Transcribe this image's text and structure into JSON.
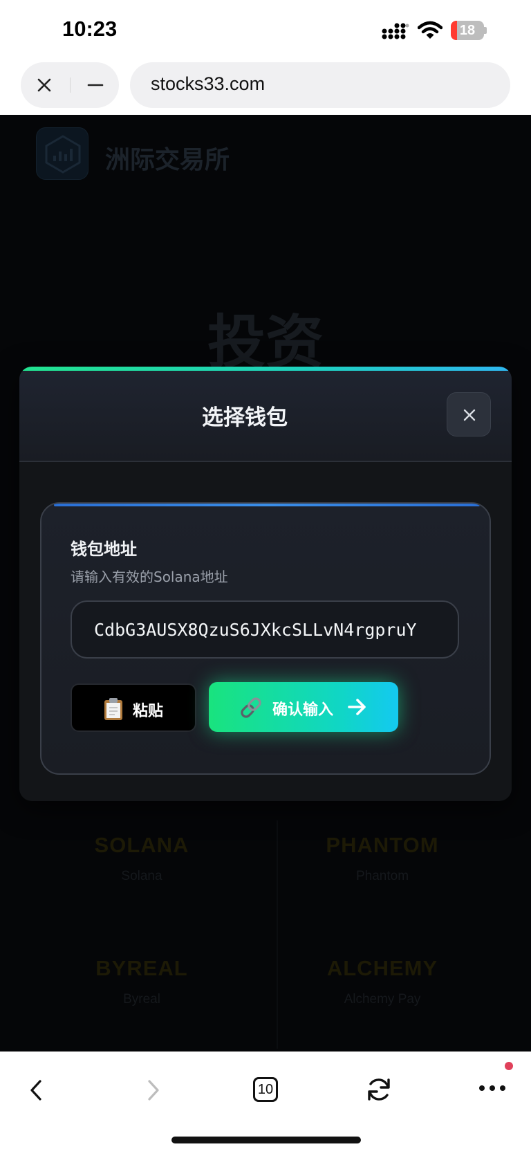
{
  "status_bar": {
    "time": "10:23",
    "battery_level": "18",
    "battery_fraction": 0.18,
    "battery_color": "#ff3b30",
    "icons": [
      "signal-icon",
      "wifi-icon",
      "battery-icon"
    ]
  },
  "browser": {
    "url": "stocks33.com",
    "tabs_count": "10",
    "icons": [
      "close-icon",
      "minimize-icon",
      "back-icon",
      "forward-icon",
      "tabs-icon",
      "reload-icon",
      "more-icon"
    ]
  },
  "page": {
    "brand": "洲际交易所",
    "hero_title": "投资",
    "wallets": [
      {
        "name": "SOLANA",
        "sub": "Solana"
      },
      {
        "name": "PHANTOM",
        "sub": "Phantom"
      },
      {
        "name": "BYREAL",
        "sub": "Byreal"
      },
      {
        "name": "ALCHEMY",
        "sub": "Alchemy Pay"
      }
    ]
  },
  "modal": {
    "title": "选择钱包",
    "accent_colors": [
      "#22e38f",
      "#2fb7f0"
    ],
    "address_label": "钱包地址",
    "address_hint": "请输入有效的Solana地址",
    "address_value": "CdbG3AUSX8QzuS6JXkcSLLvN4rgpruY",
    "paste_label": "粘贴",
    "paste_icon": "clipboard-icon",
    "confirm_label": "确认输入",
    "confirm_icons": [
      "link-icon",
      "arrow-right-icon"
    ]
  }
}
